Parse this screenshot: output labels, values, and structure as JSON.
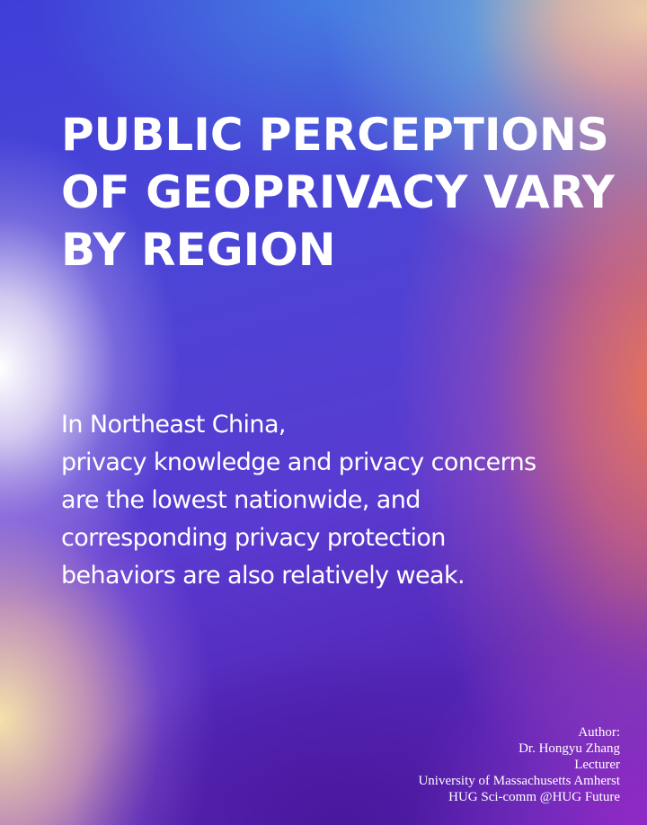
{
  "poster": {
    "title": "PUBLIC PERCEPTIONS OF GEOPRIVACY VARY BY REGION",
    "body_lines": [
      "In Northeast China,",
      "privacy knowledge and privacy concerns",
      "are the lowest nationwide, and",
      "corresponding privacy protection",
      "behaviors are also relatively weak."
    ],
    "credits": {
      "author_label": "Author:",
      "name": "Dr. Hongyu Zhang",
      "position": "Lecturer",
      "institution": "University of Massachusetts Amherst",
      "handle": "HUG Sci-comm  @HUG Future"
    }
  },
  "colors": {
    "text": "#ffffff",
    "gradient_blue": "#4b45d6",
    "gradient_cream": "#f6e8aa",
    "gradient_orange": "#f07850",
    "gradient_purple": "#5326b8"
  }
}
